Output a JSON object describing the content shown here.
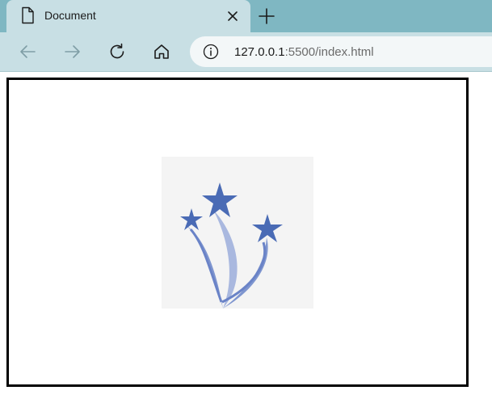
{
  "browser": {
    "tab": {
      "title": "Document",
      "icon": "document-icon"
    },
    "new_tab_icon": "plus-icon",
    "toolbar": {
      "back_icon": "arrow-left-icon",
      "forward_icon": "arrow-right-icon",
      "reload_icon": "reload-icon",
      "home_icon": "home-icon",
      "site_info_icon": "info-icon"
    },
    "address": {
      "host": "127.0.0.1",
      "rest": ":5500/index.html"
    }
  },
  "page": {
    "image": {
      "description_icon": "shooting-stars-icon",
      "background": "#f4f4f4",
      "star_color": "#4a6bb5"
    },
    "box_border_color": "#000000"
  }
}
